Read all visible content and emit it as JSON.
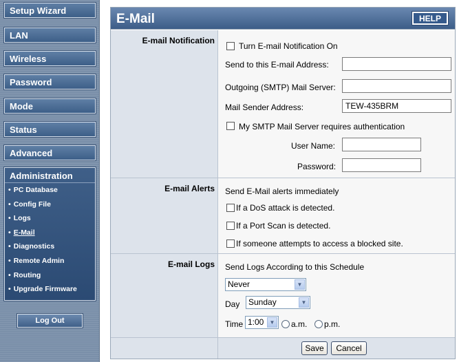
{
  "sidebar": {
    "nav": [
      {
        "label": "Setup Wizard"
      },
      {
        "label": "LAN"
      },
      {
        "label": "Wireless"
      },
      {
        "label": "Password"
      },
      {
        "label": "Mode"
      },
      {
        "label": "Status"
      },
      {
        "label": "Advanced"
      }
    ],
    "admin": {
      "title": "Administration",
      "items": [
        {
          "label": "PC Database"
        },
        {
          "label": "Config File"
        },
        {
          "label": "Logs"
        },
        {
          "label": "E-Mail",
          "active": true
        },
        {
          "label": "Diagnostics"
        },
        {
          "label": "Remote Admin"
        },
        {
          "label": "Routing"
        },
        {
          "label": "Upgrade Firmware"
        }
      ]
    },
    "logout_label": "Log Out"
  },
  "header": {
    "title": "E-Mail",
    "help_label": "HELP"
  },
  "notification": {
    "section_label": "E-mail Notification",
    "turn_on_label": "Turn E-mail Notification On",
    "turn_on_checked": false,
    "send_to_label": "Send to this E-mail Address:",
    "send_to_value": "",
    "smtp_label": "Outgoing (SMTP) Mail Server:",
    "smtp_value": "",
    "sender_label": "Mail Sender Address:",
    "sender_value": "TEW-435BRM",
    "auth_label": "My SMTP Mail Server requires authentication",
    "auth_checked": false,
    "username_label": "User Name:",
    "username_value": "",
    "password_label": "Password:",
    "password_value": ""
  },
  "alerts": {
    "section_label": "E-mail Alerts",
    "intro": "Send E-Mail alerts immediately",
    "dos_label": "If a DoS attack is detected.",
    "portscan_label": "If a Port Scan is detected.",
    "blocked_label": "If someone attempts to access a blocked site."
  },
  "logs": {
    "section_label": "E-mail Logs",
    "intro": "Send Logs According to this Schedule",
    "schedule_value": "Never",
    "day_label": "Day",
    "day_value": "Sunday",
    "time_label": "Time",
    "time_value": "1:00",
    "am_label": "a.m.",
    "pm_label": "p.m."
  },
  "actions": {
    "save_label": "Save",
    "cancel_label": "Cancel"
  },
  "colors": {
    "sidebar_bg": "#7a8fa9",
    "nav_button": "#4a6c96",
    "label_cell": "#dde3eb",
    "body_cell": "#f7f7f7"
  },
  "icons": {
    "dropdown": "chevron-down-icon",
    "bullet": "bullet-icon"
  }
}
